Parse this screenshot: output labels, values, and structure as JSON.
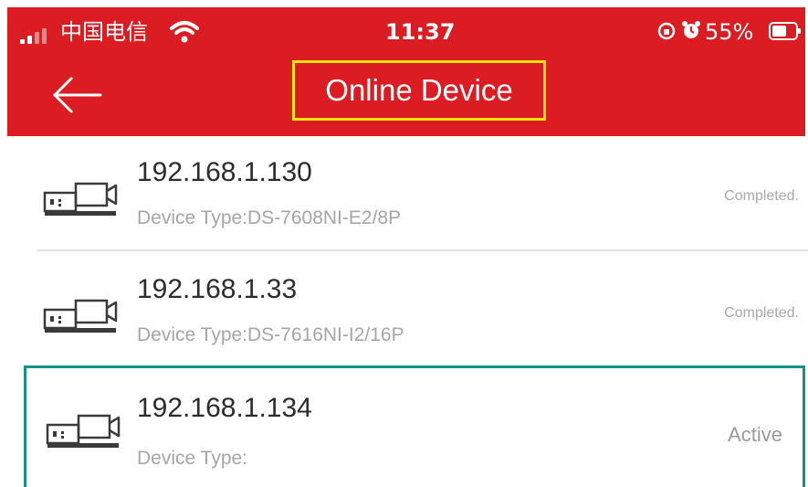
{
  "status_bar": {
    "carrier": "中国电信",
    "time": "11:37",
    "battery_percent": "55%"
  },
  "header": {
    "title": "Online Device",
    "back_icon": "arrow-left-icon"
  },
  "colors": {
    "header_background": "#dc1c23",
    "title_highlight": "#f1e50b",
    "row_highlight": "#12918f"
  },
  "devices": [
    {
      "ip": "192.168.1.130",
      "type_label": "Device Type:DS-7608NI-E2/8P",
      "status": "Completed.",
      "icon": "nvr-device-icon"
    },
    {
      "ip": "192.168.1.33",
      "type_label": "Device Type:DS-7616NI-I2/16P",
      "status": "Completed.",
      "icon": "nvr-device-icon"
    },
    {
      "ip": "192.168.1.134",
      "type_label": "Device Type:",
      "status": "Active",
      "icon": "nvr-device-icon",
      "highlighted": true
    }
  ]
}
